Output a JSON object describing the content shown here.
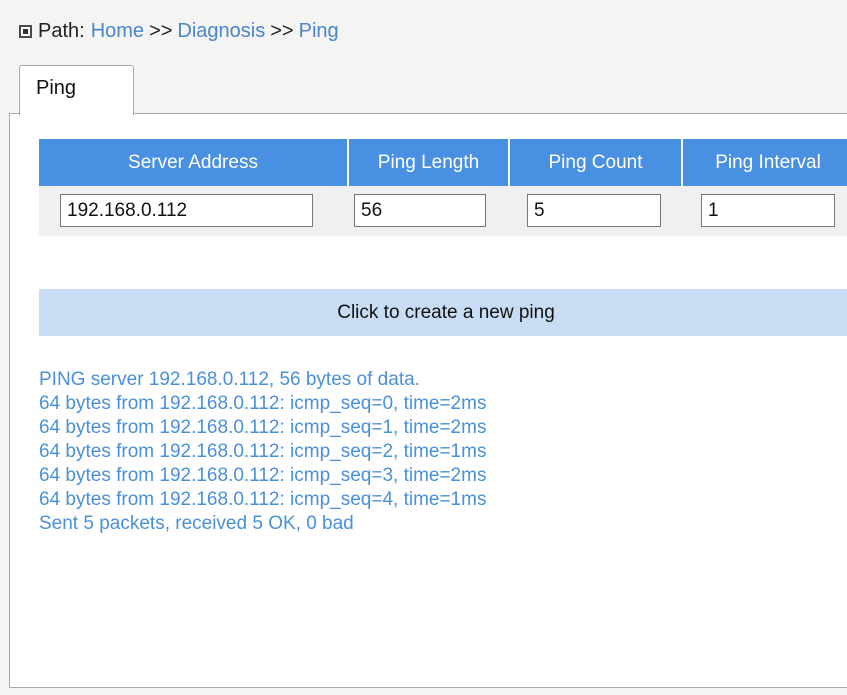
{
  "breadcrumb": {
    "prefix": "Path:",
    "items": [
      "Home",
      "Diagnosis",
      "Ping"
    ],
    "separator": ">>"
  },
  "tabs": [
    {
      "label": "Ping",
      "active": true
    }
  ],
  "table": {
    "headers": {
      "server_address": "Server Address",
      "ping_length": "Ping Length",
      "ping_count": "Ping Count",
      "ping_interval": "Ping Interval"
    },
    "values": {
      "server_address": "192.168.0.112",
      "ping_length": "56",
      "ping_count": "5",
      "ping_interval": "1"
    }
  },
  "action": {
    "label": "Click to create a new ping"
  },
  "output": [
    "PING server 192.168.0.112, 56 bytes of data.",
    "64 bytes from 192.168.0.112: icmp_seq=0, time=2ms",
    "64 bytes from 192.168.0.112: icmp_seq=1, time=2ms",
    "64 bytes from 192.168.0.112: icmp_seq=2, time=1ms",
    "64 bytes from 192.168.0.112: icmp_seq=3, time=2ms",
    "64 bytes from 192.168.0.112: icmp_seq=4, time=1ms",
    "Sent 5 packets, received 5 OK, 0 bad"
  ],
  "colors": {
    "header_bg": "#4a90e2",
    "button_bg": "#c8dcf3",
    "link": "#4a86c8",
    "output_text": "#4a90d9"
  }
}
